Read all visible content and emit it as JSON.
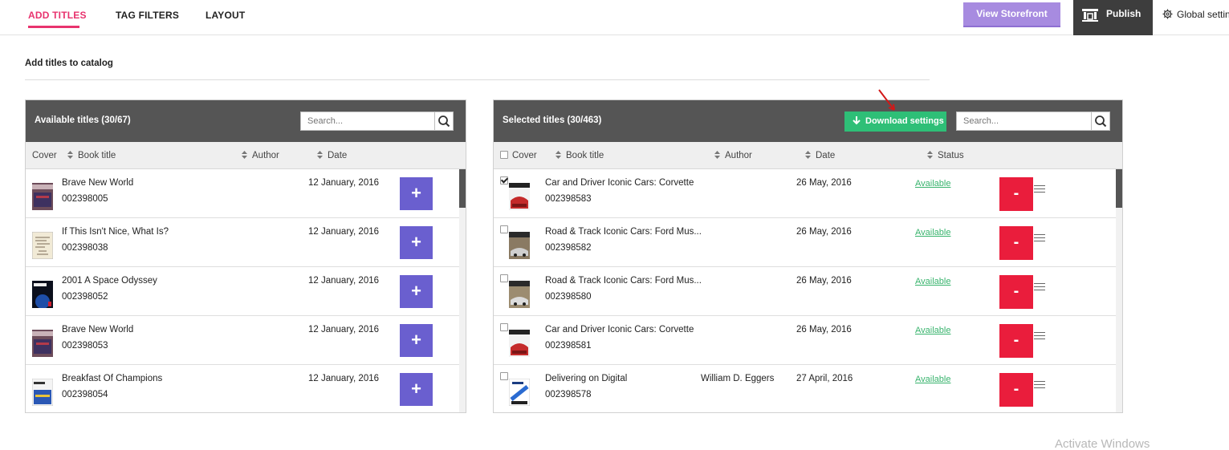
{
  "nav": {
    "tabs": [
      "ADD TITLES",
      "TAG FILTERS",
      "LAYOUT"
    ],
    "active_tab": "ADD TITLES",
    "view_storefront": "View Storefront",
    "publish": "Publish",
    "global_settings": "Global settin"
  },
  "section_title": "Add titles to catalog",
  "available": {
    "title": "Available titles (30/67)",
    "search_placeholder": "Search...",
    "columns": {
      "cover": "Cover",
      "book_title": "Book title",
      "author": "Author",
      "date": "Date"
    },
    "add_label": "+",
    "rows": [
      {
        "title": "Brave New World",
        "id": "002398005",
        "date": "12 January, 2016",
        "author": ""
      },
      {
        "title": "If This Isn't Nice, What Is?",
        "id": "002398038",
        "date": "12 January, 2016",
        "author": ""
      },
      {
        "title": "2001 A Space Odyssey",
        "id": "002398052",
        "date": "12 January, 2016",
        "author": ""
      },
      {
        "title": "Brave New World",
        "id": "002398053",
        "date": "12 January, 2016",
        "author": ""
      },
      {
        "title": "Breakfast Of Champions",
        "id": "002398054",
        "date": "12 January, 2016",
        "author": ""
      }
    ]
  },
  "selected": {
    "title": "Selected titles (30/463)",
    "download_settings": "Download settings",
    "search_placeholder": "Search...",
    "columns": {
      "cover": "Cover",
      "book_title": "Book title",
      "author": "Author",
      "date": "Date",
      "status": "Status"
    },
    "remove_label": "-",
    "rows": [
      {
        "title": "Car and Driver Iconic Cars: Corvette",
        "id": "002398583",
        "date": "26 May, 2016",
        "author": "",
        "status": "Available",
        "checked": true
      },
      {
        "title": "Road & Track Iconic Cars: Ford Mus...",
        "id": "002398582",
        "date": "26 May, 2016",
        "author": "",
        "status": "Available",
        "checked": false
      },
      {
        "title": "Road & Track Iconic Cars: Ford Mus...",
        "id": "002398580",
        "date": "26 May, 2016",
        "author": "",
        "status": "Available",
        "checked": false
      },
      {
        "title": "Car and Driver Iconic Cars: Corvette",
        "id": "002398581",
        "date": "26 May, 2016",
        "author": "",
        "status": "Available",
        "checked": false
      },
      {
        "title": "Delivering on Digital",
        "id": "002398578",
        "date": "27 April, 2016",
        "author": "William D. Eggers",
        "status": "Available",
        "checked": false
      }
    ]
  },
  "watermark": "Activate Windows",
  "colors": {
    "accent_pink": "#e8336e",
    "storefront_purple": "#a78be0",
    "add_purple": "#6a5fcf",
    "remove_red": "#ea1d3c",
    "download_green": "#2ebf77",
    "status_green": "#37b36c",
    "header_gray": "#555555"
  }
}
